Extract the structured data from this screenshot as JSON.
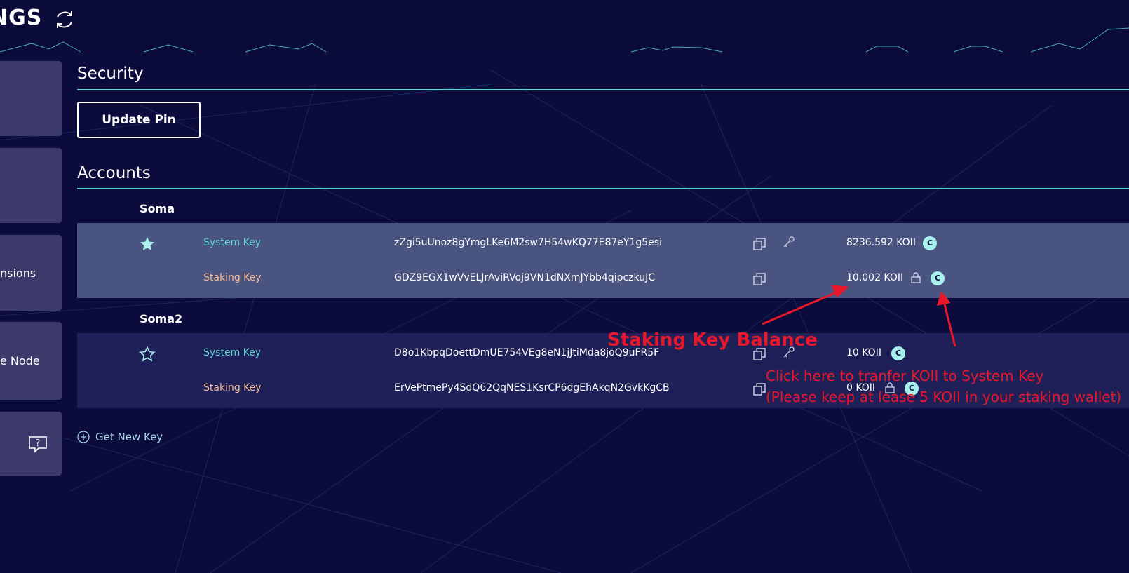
{
  "header": {
    "title": "NGS",
    "refresh_icon": "refresh-icon"
  },
  "sidebar": {
    "items": [
      {
        "label": ""
      },
      {
        "label": ""
      },
      {
        "label": "nsions"
      },
      {
        "label": "e Node"
      },
      {
        "label": "",
        "icon": "help-chat-icon"
      }
    ]
  },
  "security": {
    "title": "Security",
    "update_pin_label": "Update Pin"
  },
  "accounts": {
    "title": "Accounts",
    "list": [
      {
        "name": "Soma",
        "default": true,
        "system": {
          "label": "System Key",
          "address": "zZgi5uUnoz8gYmgLKe6M2sw7H54wKQ77E87eY1g5esi",
          "balance": "8236.592 KOII"
        },
        "staking": {
          "label": "Staking Key",
          "address": "GDZ9EGX1wVvELJrAviRVoj9VN1dNXmJYbb4qipczkuJC",
          "balance": "10.002 KOII"
        }
      },
      {
        "name": "Soma2",
        "default": false,
        "system": {
          "label": "System Key",
          "address": "D8o1KbpqDoettDmUE754VEg8eN1jJtiMda8joQ9uFR5F",
          "balance": "10 KOII"
        },
        "staking": {
          "label": "Staking Key",
          "address": "ErVePtmePy4SdQ62QqNES1KsrCP6dgEhAkqN2GvkKgCB",
          "balance": "0 KOII"
        }
      }
    ],
    "get_new_key": "Get New Key"
  },
  "annotations": {
    "balance_note": "Staking Key Balance",
    "transfer_line1": "Click here to tranfer KOII to System Key",
    "transfer_line2": "(Please keep at lease 5 KOII in your staking wallet)"
  },
  "colors": {
    "background": "#0b0b3a",
    "accent": "#5ed4d0",
    "staking_label": "#f5b994",
    "selected_row": "#4a5480",
    "annotation": "#e8172a"
  }
}
